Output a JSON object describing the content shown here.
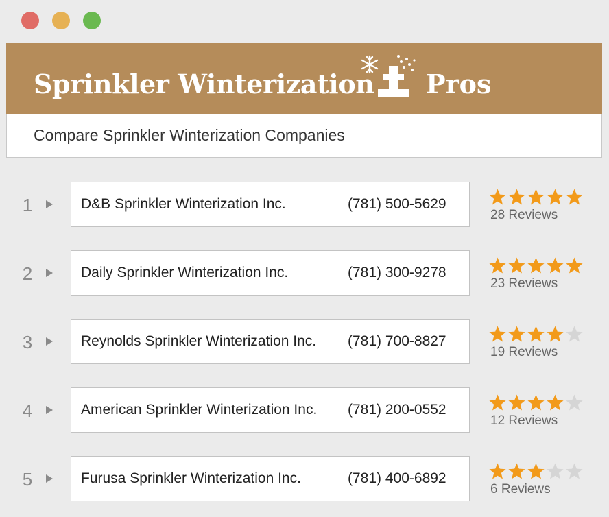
{
  "window": {
    "controls": [
      {
        "name": "close",
        "color": "#e06c66"
      },
      {
        "name": "minimize",
        "color": "#e6b154"
      },
      {
        "name": "maximize",
        "color": "#6ab950"
      }
    ]
  },
  "header": {
    "brand_left": "Sprinkler Winterization",
    "brand_right": "Pros",
    "logo_icon": "snowflake-sprinkler-icon",
    "background": "#b58c5a",
    "subtitle": "Compare Sprinkler Winterization Companies"
  },
  "colors": {
    "star_filled": "#f29a1a",
    "star_empty": "#d5d5d5"
  },
  "listings": [
    {
      "rank": "1",
      "name": "D&B Sprinkler Winterization Inc.",
      "phone": "(781) 500-5629",
      "rating": 5,
      "reviews": "28 Reviews"
    },
    {
      "rank": "2",
      "name": "Daily Sprinkler Winterization Inc.",
      "phone": "(781) 300-9278",
      "rating": 5,
      "reviews": "23 Reviews"
    },
    {
      "rank": "3",
      "name": "Reynolds Sprinkler Winterization Inc.",
      "phone": "(781) 700-8827",
      "rating": 4,
      "reviews": "19 Reviews"
    },
    {
      "rank": "4",
      "name": "American Sprinkler Winterization Inc.",
      "phone": "(781) 200-0552",
      "rating": 4,
      "reviews": "12 Reviews"
    },
    {
      "rank": "5",
      "name": "Furusa Sprinkler Winterization Inc.",
      "phone": "(781) 400-6892",
      "rating": 3,
      "reviews": "6 Reviews"
    }
  ]
}
